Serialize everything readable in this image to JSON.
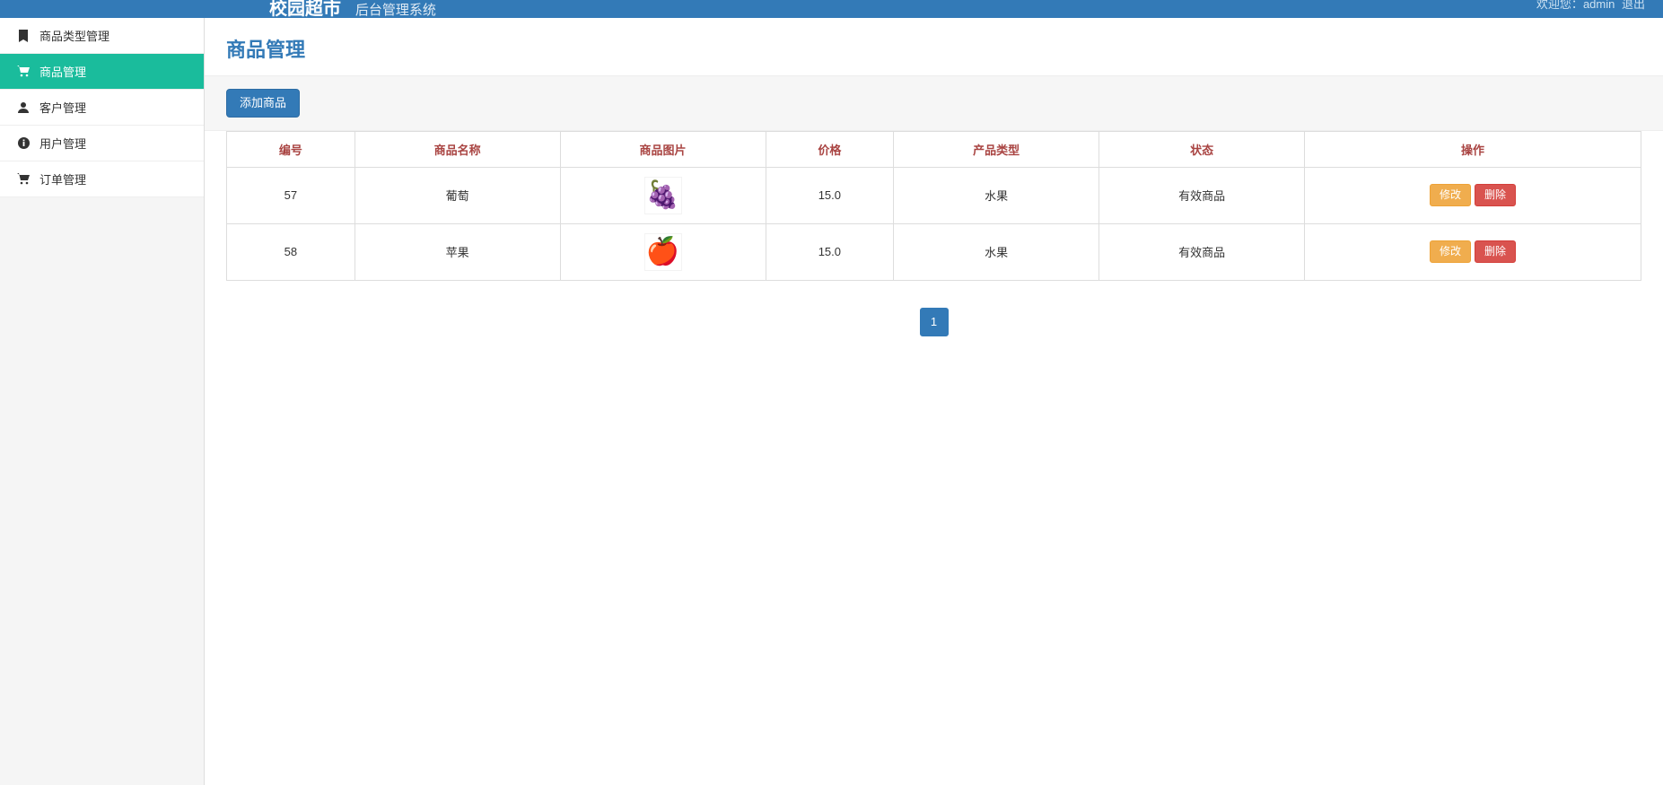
{
  "header": {
    "brand": "校园超市",
    "subtitle": "后台管理系统",
    "welcome_prefix": "欢迎您：",
    "username": "admin",
    "logout": "退出"
  },
  "sidebar": {
    "items": [
      {
        "icon": "bookmark",
        "label": "商品类型管理",
        "active": false
      },
      {
        "icon": "cart",
        "label": "商品管理",
        "active": true
      },
      {
        "icon": "user",
        "label": "客户管理",
        "active": false
      },
      {
        "icon": "info",
        "label": "用户管理",
        "active": false
      },
      {
        "icon": "cart",
        "label": "订单管理",
        "active": false
      }
    ]
  },
  "page": {
    "title": "商品管理",
    "add_button": "添加商品"
  },
  "table": {
    "columns": [
      "编号",
      "商品名称",
      "商品图片",
      "价格",
      "产品类型",
      "状态",
      "操作"
    ],
    "actions": {
      "edit": "修改",
      "delete": "删除"
    },
    "rows": [
      {
        "id": "57",
        "name": "葡萄",
        "image_icon": "🍇",
        "price": "15.0",
        "category": "水果",
        "status": "有效商品"
      },
      {
        "id": "58",
        "name": "苹果",
        "image_icon": "🍎",
        "price": "15.0",
        "category": "水果",
        "status": "有效商品"
      }
    ]
  },
  "pagination": {
    "pages": [
      "1"
    ],
    "current": "1"
  }
}
